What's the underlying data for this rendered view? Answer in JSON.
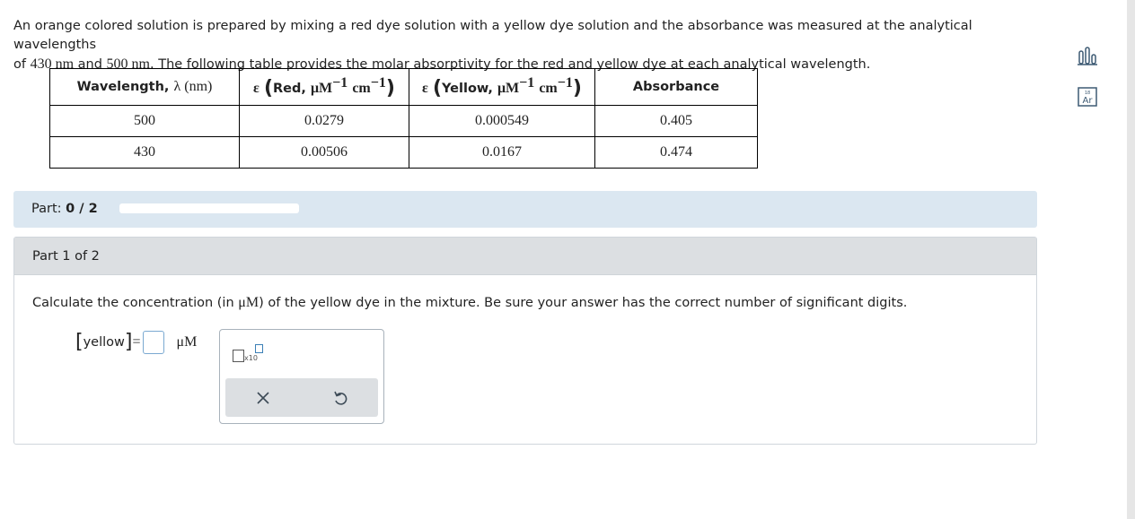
{
  "intro": {
    "line1": "An orange colored solution is prepared by mixing a red dye solution with a yellow dye solution and the absorbance was measured at the analytical wavelengths",
    "line2_pre": "of ",
    "v1": "430 nm",
    "and": " and ",
    "v2": "500 nm",
    "line2_post": ". The following table provides the molar absorptivity for the red and yellow dye at each analytical wavelength."
  },
  "table": {
    "headers": {
      "wavelength_text": "Wavelength, ",
      "wavelength_sym": "λ (nm)",
      "eps": "ε",
      "red": "Red, ",
      "yellow": "Yellow, ",
      "unit_um": "μM",
      "unit_cm": "cm",
      "exp": "−1",
      "absorbance": "Absorbance"
    },
    "rows": [
      {
        "wavelength": "500",
        "red": "0.0279",
        "yellow": "0.000549",
        "absorbance": "0.405"
      },
      {
        "wavelength": "430",
        "red": "0.00506",
        "yellow": "0.0167",
        "absorbance": "0.474"
      }
    ]
  },
  "part_bar": {
    "label": "Part: ",
    "value": "0 / 2",
    "progress": 0
  },
  "part": {
    "title": "Part 1 of 2",
    "question_pre": "Calculate the concentration (in ",
    "question_unit": "μM",
    "question_post": ") of the yellow dye in the mixture. Be sure your answer has the correct number of significant digits.",
    "answer_var": "yellow",
    "answer_eq": "=",
    "answer_unit": "μM",
    "answer_value": ""
  },
  "palette": {
    "sci_label": "x10",
    "clear_icon": "close-icon",
    "undo_icon": "undo-icon"
  },
  "side_tools": [
    {
      "name": "data-chart-icon"
    },
    {
      "name": "periodic-table-icon",
      "sym": "Ar",
      "num": "18"
    }
  ],
  "colors": {
    "part_bar": "#dbe7f1",
    "part_header": "#dcdfe2",
    "input_border": "#7aa9d1"
  }
}
